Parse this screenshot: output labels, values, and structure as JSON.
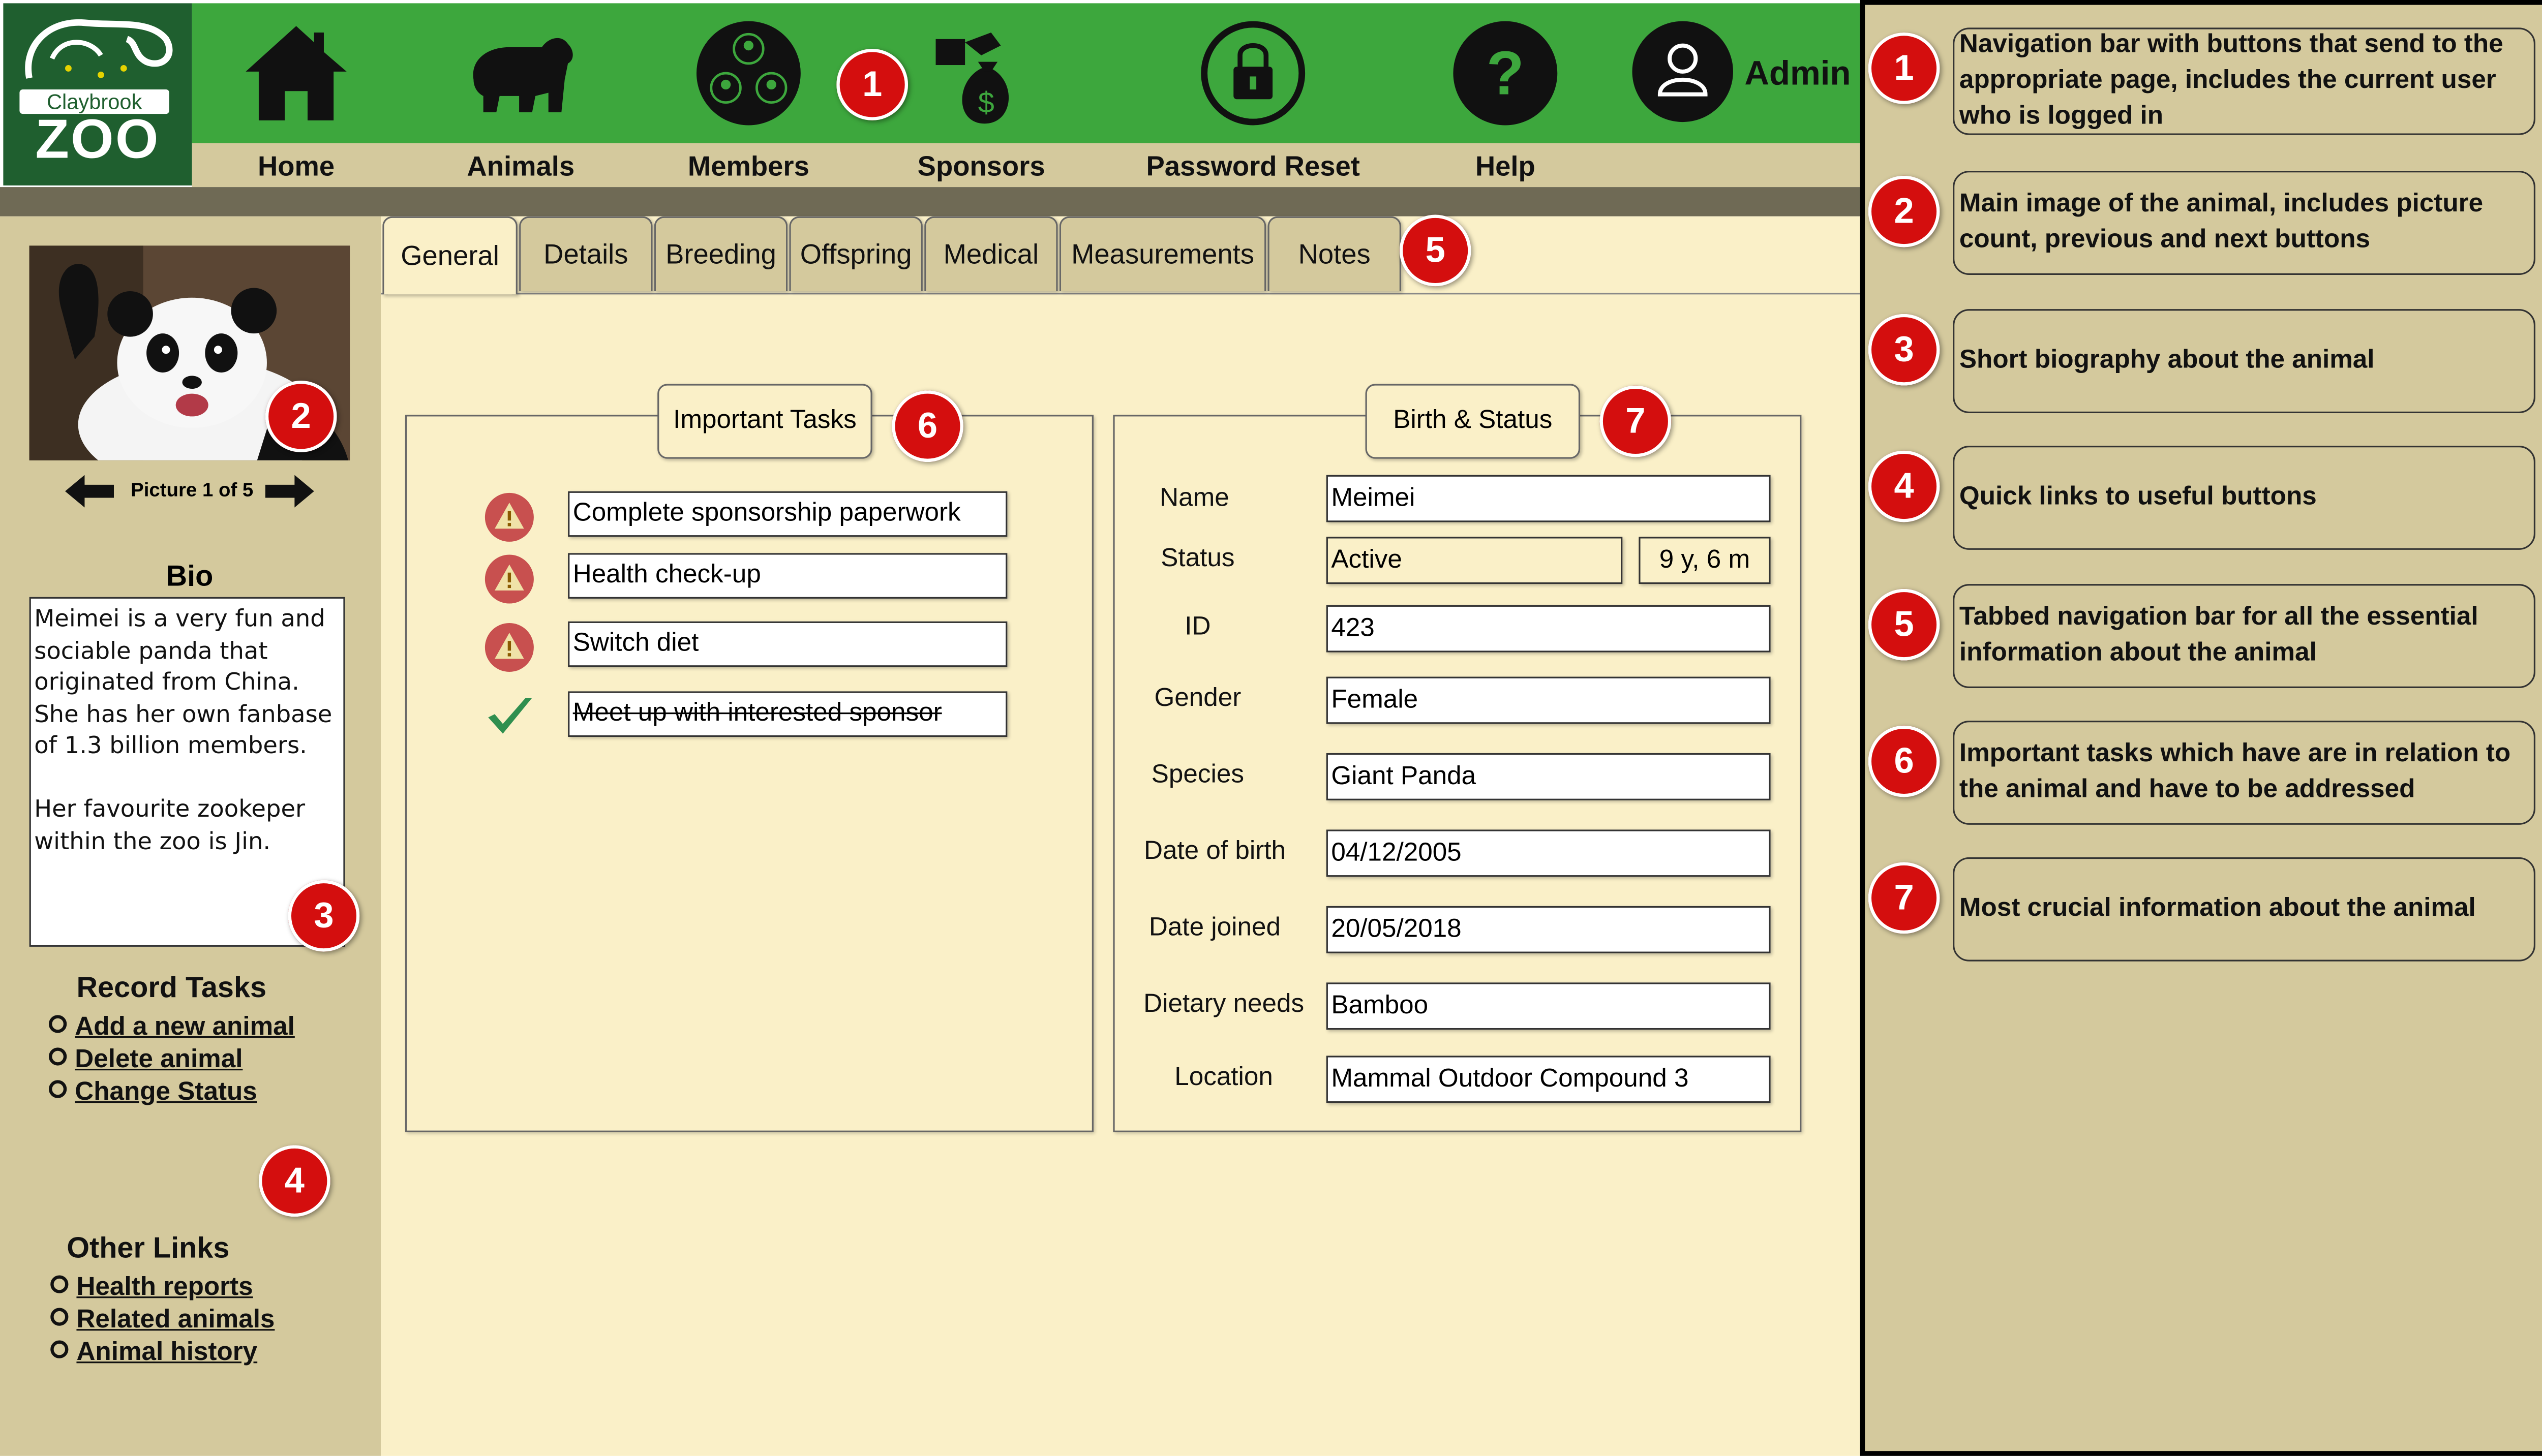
{
  "logo": {
    "name": "Claybrook",
    "word": "ZOO"
  },
  "nav": {
    "items": [
      {
        "label": "Home",
        "icon": "home-icon"
      },
      {
        "label": "Animals",
        "icon": "bear-icon"
      },
      {
        "label": "Members",
        "icon": "members-icon"
      },
      {
        "label": "Sponsors",
        "icon": "sponsor-money-icon"
      },
      {
        "label": "Password Reset",
        "icon": "lock-icon"
      },
      {
        "label": "Help",
        "icon": "help-icon"
      }
    ],
    "user": "Admin"
  },
  "animal_image": {
    "counter": "Picture 1 of 5"
  },
  "bio": {
    "title": "Bio",
    "text": "Meimei is a very fun and sociable panda that originated from China. She has her own fanbase of 1.3 billion members.\n\nHer favourite zookeper within the zoo is Jin."
  },
  "record_tasks": {
    "title": "Record Tasks",
    "links": [
      "Add a new animal",
      "Delete animal",
      "Change Status"
    ]
  },
  "other_links": {
    "title": "Other Links",
    "links": [
      "Health reports",
      "Related animals",
      "Animal history"
    ]
  },
  "tabs": [
    "General",
    "Details",
    "Breeding",
    "Offspring",
    "Medical",
    "Measurements",
    "Notes"
  ],
  "active_tab": "General",
  "important_tasks": {
    "title": "Important Tasks",
    "items": [
      {
        "text": "Complete sponsorship paperwork",
        "status": "warning"
      },
      {
        "text": "Health check-up",
        "status": "warning"
      },
      {
        "text": "Switch diet",
        "status": "warning"
      },
      {
        "text": "Meet up with interested sponsor",
        "status": "done"
      }
    ]
  },
  "birth_status": {
    "title": "Birth & Status",
    "name_label": "Name",
    "name": "Meimei",
    "status_label": "Status",
    "status": "Active",
    "age": "9 y, 6 m",
    "id_label": "ID",
    "id": "423",
    "gender_label": "Gender",
    "gender": "Female",
    "species_label": "Species",
    "species": "Giant Panda",
    "dob_label": "Date of birth",
    "dob": "04/12/2005",
    "joined_label": "Date joined",
    "joined": "20/05/2018",
    "diet_label": "Dietary needs",
    "diet": "Bamboo",
    "location_label": "Location",
    "location": "Mammal Outdoor Compound 3"
  },
  "annotations": [
    {
      "num": "1",
      "text": "Navigation bar with buttons that send to the appropriate page, includes the current user who is logged in"
    },
    {
      "num": "2",
      "text": "Main image of the animal, includes picture count, previous and next buttons"
    },
    {
      "num": "3",
      "text": "Short biography about the animal"
    },
    {
      "num": "4",
      "text": "Quick links to useful buttons"
    },
    {
      "num": "5",
      "text": "Tabbed navigation bar for all the essential information about the animal"
    },
    {
      "num": "6",
      "text": "Important tasks which have are in relation to the animal and have to be addressed"
    },
    {
      "num": "7",
      "text": "Most crucial information about the animal"
    }
  ],
  "colors": {
    "nav_green": "#3da73d",
    "logo_green": "#1f5f2f",
    "tan": "#d4c99d",
    "cream": "#faf0c8",
    "callout_red": "#d40e0e"
  }
}
